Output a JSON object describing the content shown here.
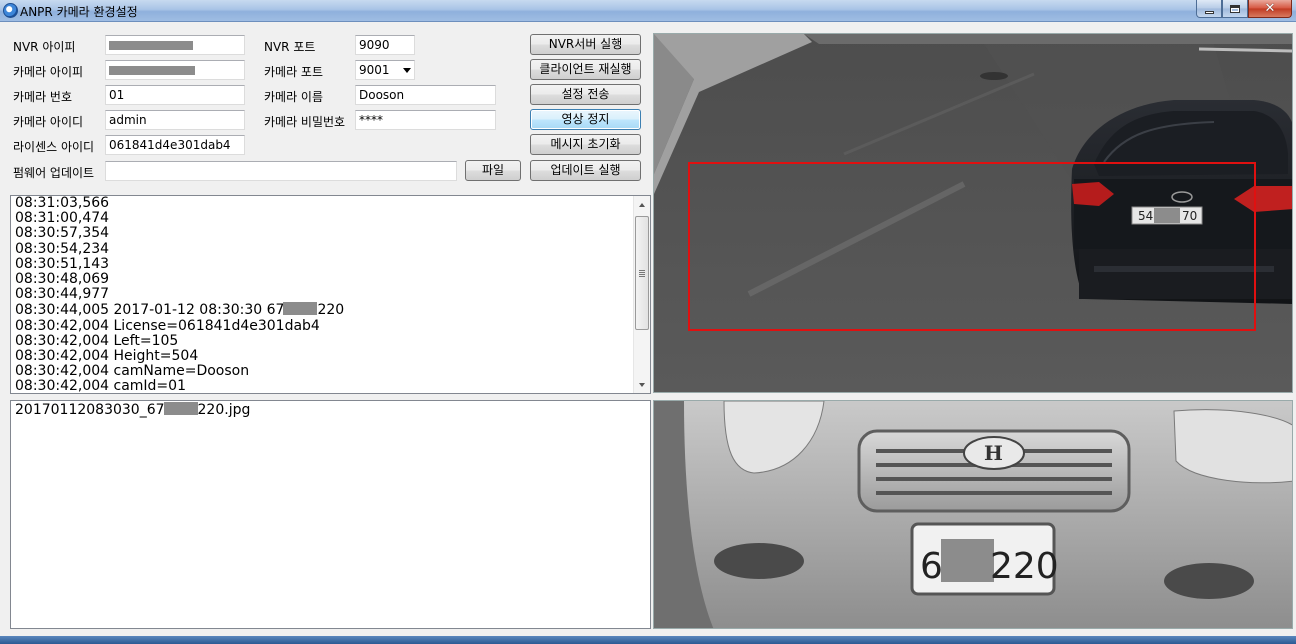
{
  "window": {
    "title": "ANPR 카메라 환경설정"
  },
  "form": {
    "nvr_ip_label": "NVR 아이피",
    "camera_ip_label": "카메라 아이피",
    "camera_no_label": "카메라 번호",
    "camera_no_value": "01",
    "camera_id_label": "카메라 아이디",
    "camera_id_value": "admin",
    "license_id_label": "라이센스 아이디",
    "license_id_value": "061841d4e301dab4",
    "firmware_label": "펌웨어 업데이트",
    "firmware_value": "",
    "nvr_port_label": "NVR 포트",
    "nvr_port_value": "9090",
    "camera_port_label": "카메라 포트",
    "camera_port_value": "9001",
    "camera_name_label": "카메라 이름",
    "camera_name_value": "Dooson",
    "camera_pw_label": "카메라 비밀번호",
    "camera_pw_value": "****"
  },
  "buttons": {
    "file": "파일",
    "nvr_server_run": "NVR서버 실행",
    "client_restart": "클라이언트 재실행",
    "send_settings": "설정 전송",
    "stop_video": "영상 정지",
    "reset_message": "메시지 초기화",
    "run_update": "업데이트 실행"
  },
  "log": {
    "lines": [
      "08:31:03,566",
      "08:31:00,474",
      "08:30:57,354",
      "08:30:54,234",
      "08:30:51,143",
      "08:30:48,069",
      "08:30:44,977",
      "08:30:44,005 2017-01-12 08:30:30 67",
      "08:30:42,004 License=061841d4e301dab4",
      "08:30:42,004 Left=105",
      "08:30:42,004 Height=504",
      "08:30:42,004 camName=Dooson",
      "08:30:42,004 camId=01"
    ],
    "redacted_suffix": "220"
  },
  "files": {
    "item_prefix": "20170112083030_67",
    "item_suffix": "220.jpg"
  },
  "camera_view": {
    "plate_left": "54",
    "plate_right": "70",
    "detection_box_color": "#e01010"
  },
  "snapshot": {
    "plate_left": "67",
    "plate_right": "220"
  },
  "colors": {
    "window_bg": "#f0f0f0",
    "titlebar": "#a9c4e6"
  }
}
